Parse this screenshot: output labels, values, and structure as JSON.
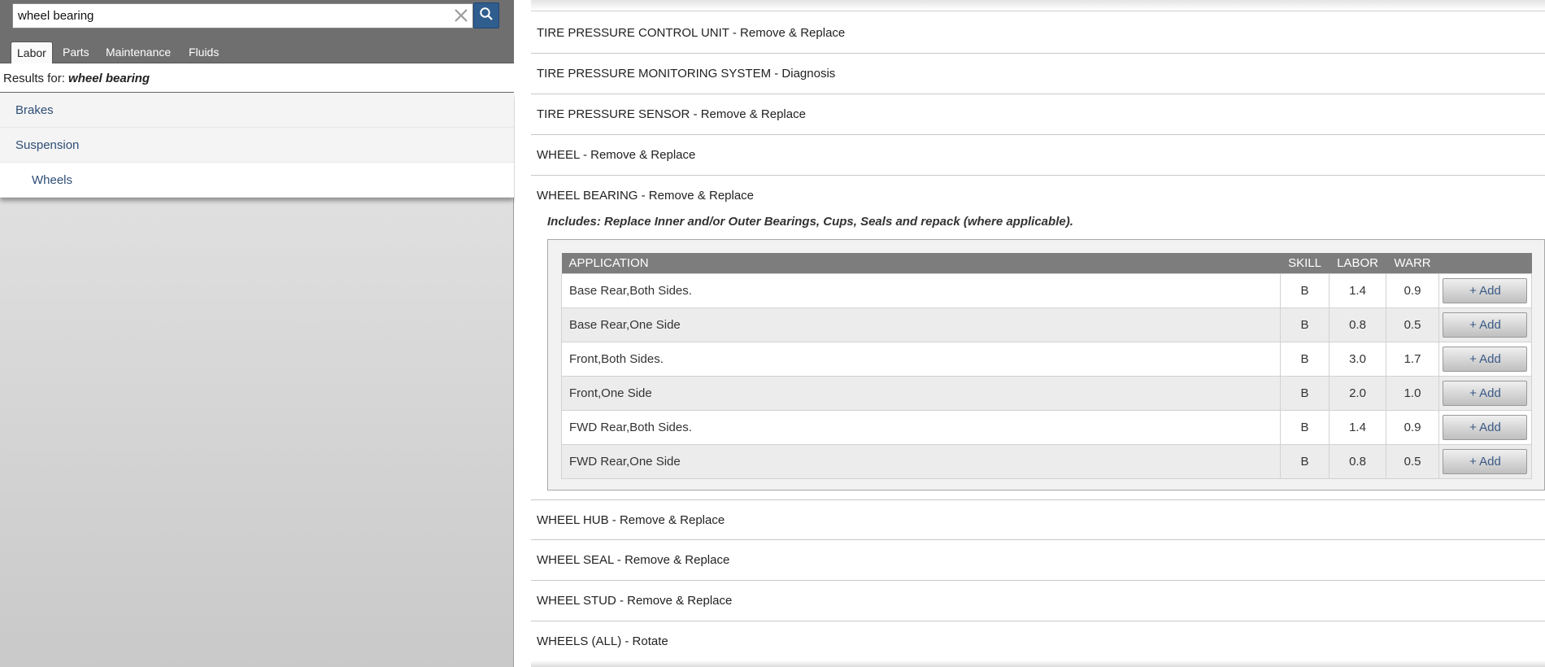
{
  "search": {
    "value": "wheel bearing",
    "placeholder": ""
  },
  "tabs": [
    {
      "label": "Labor",
      "active": true
    },
    {
      "label": "Parts",
      "active": false
    },
    {
      "label": "Maintenance",
      "active": false
    },
    {
      "label": "Fluids",
      "active": false
    }
  ],
  "results": {
    "prefix": "Results for:",
    "query": "wheel bearing"
  },
  "categories": [
    {
      "label": "Brakes"
    },
    {
      "label": "Suspension"
    },
    {
      "label": "Wheels"
    }
  ],
  "operations_above": [
    "TIRE PRESSURE CONTROL UNIT - Remove & Replace",
    "TIRE PRESSURE MONITORING SYSTEM - Diagnosis",
    "TIRE PRESSURE SENSOR - Remove & Replace",
    "WHEEL - Remove & Replace",
    "WHEEL BEARING - Remove & Replace"
  ],
  "expanded": {
    "includes": "Includes: Replace Inner and/or Outer Bearings, Cups, Seals and repack (where applicable).",
    "columns": [
      "APPLICATION",
      "SKILL",
      "LABOR",
      "WARR"
    ],
    "add_label": "+ Add",
    "rows": [
      {
        "application": "Base Rear,Both Sides.",
        "skill": "B",
        "labor": "1.4",
        "warr": "0.9"
      },
      {
        "application": "Base Rear,One Side",
        "skill": "B",
        "labor": "0.8",
        "warr": "0.5"
      },
      {
        "application": "Front,Both Sides.",
        "skill": "B",
        "labor": "3.0",
        "warr": "1.7"
      },
      {
        "application": "Front,One Side",
        "skill": "B",
        "labor": "2.0",
        "warr": "1.0"
      },
      {
        "application": "FWD Rear,Both Sides.",
        "skill": "B",
        "labor": "1.4",
        "warr": "0.9"
      },
      {
        "application": "FWD Rear,One Side",
        "skill": "B",
        "labor": "0.8",
        "warr": "0.5"
      }
    ]
  },
  "operations_below": [
    "WHEEL HUB - Remove & Replace",
    "WHEEL SEAL - Remove & Replace",
    "WHEEL STUD - Remove & Replace",
    "WHEELS (ALL) - Rotate"
  ],
  "colors": {
    "accent": "#2f5d8e",
    "link": "#2e4e76",
    "header_bar": "#6f6f6f",
    "table_header": "#7d7d7d"
  },
  "icons": {
    "clear": "close-icon",
    "search": "search-icon"
  }
}
